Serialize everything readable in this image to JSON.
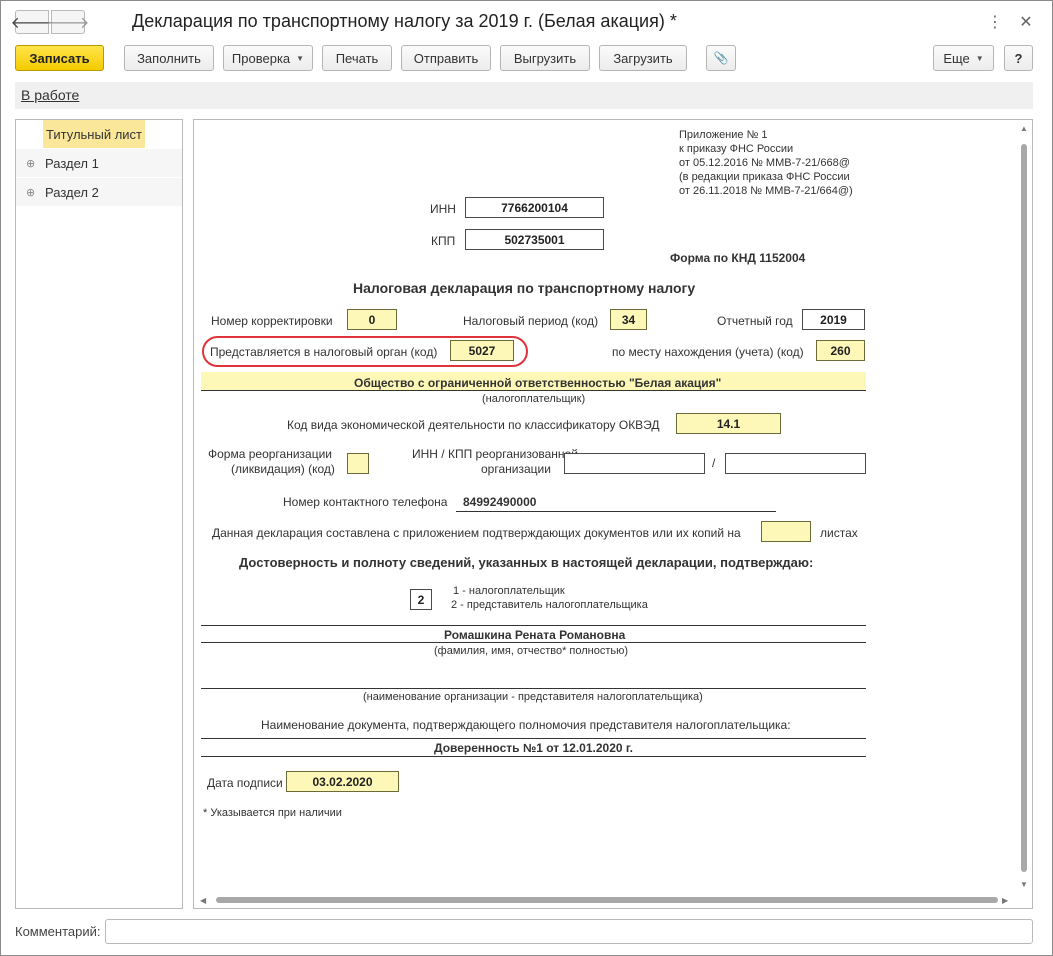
{
  "window": {
    "title": "Декларация по транспортному налогу за 2019 г. (Белая акация) *",
    "back_glyph": "🡐",
    "forward_glyph": "🡒",
    "more_glyph": "⋮",
    "close_glyph": "✕"
  },
  "toolbar": {
    "save_label": "Записать",
    "fill_label": "Заполнить",
    "check_label": "Проверка",
    "print_label": "Печать",
    "send_label": "Отправить",
    "export_label": "Выгрузить",
    "import_label": "Загрузить",
    "attach_glyph": "📎",
    "more_label": "Еще",
    "help_label": "?"
  },
  "status": {
    "link": "В работе"
  },
  "sidebar": {
    "items": [
      {
        "label": "Титульный лист",
        "selected": true
      },
      {
        "label": "Раздел 1",
        "expander": "⊕"
      },
      {
        "label": "Раздел 2",
        "expander": "⊕"
      }
    ]
  },
  "form": {
    "appendix": [
      "Приложение № 1",
      "к приказу ФНС России",
      "от 05.12.2016 № ММВ-7-21/668@",
      "(в редакции приказа ФНС России",
      "от 26.11.2018 № ММВ-7-21/664@)"
    ],
    "inn_label": "ИНН",
    "inn": "7766200104",
    "kpp_label": "КПП",
    "kpp": "502735001",
    "knd": "Форма по КНД 1152004",
    "heading": "Налоговая декларация по транспортному налогу",
    "correction_label": "Номер корректировки",
    "correction": "0",
    "period_label": "Налоговый период (код)",
    "period": "34",
    "year_label": "Отчетный год",
    "year": "2019",
    "authority_label": "Представляется в налоговый орган (код)",
    "authority": "5027",
    "location_label": "по месту нахождения (учета) (код)",
    "location": "260",
    "org_name": "Общество с ограниченной ответственностью \"Белая акация\"",
    "org_caption": "(налогоплательщик)",
    "okved_label": "Код вида экономической деятельности по классификатору ОКВЭД",
    "okved": "14.1",
    "reorg_label_1": "Форма реорганизации",
    "reorg_label_2": "(ликвидация) (код)",
    "reorg": "",
    "reorg_inn_label_1": "ИНН / КПП реорганизованной",
    "reorg_inn_label_2": "организации",
    "reorg_inn": "",
    "reorg_kpp": "",
    "slash": "/",
    "phone_label": "Номер контактного телефона",
    "phone": "84992490000",
    "attachments_label": "Данная декларация составлена с приложением подтверждающих документов или их копий на",
    "attachments": "",
    "sheets_label": "листах",
    "confirm_heading": "Достоверность и полноту сведений, указанных в настоящей декларации, подтверждаю:",
    "signer_code": "2",
    "signer_option_1": "1 - налогоплательщик",
    "signer_option_2": "2 - представитель налогоплательщика",
    "signer_name": "Ромашкина Рената Романовна",
    "signer_caption": "(фамилия, имя, отчество* полностью)",
    "rep_org_caption": "(наименование организации - представителя налогоплательщика)",
    "doc_label": "Наименование документа, подтверждающего полномочия представителя налогоплательщика:",
    "doc": "Доверенность №1 от 12.01.2020 г.",
    "sign_date_label": "Дата подписи",
    "sign_date": "03.02.2020",
    "footnote": "* Указывается при наличии"
  },
  "comment": {
    "label": "Комментарий:",
    "value": ""
  }
}
